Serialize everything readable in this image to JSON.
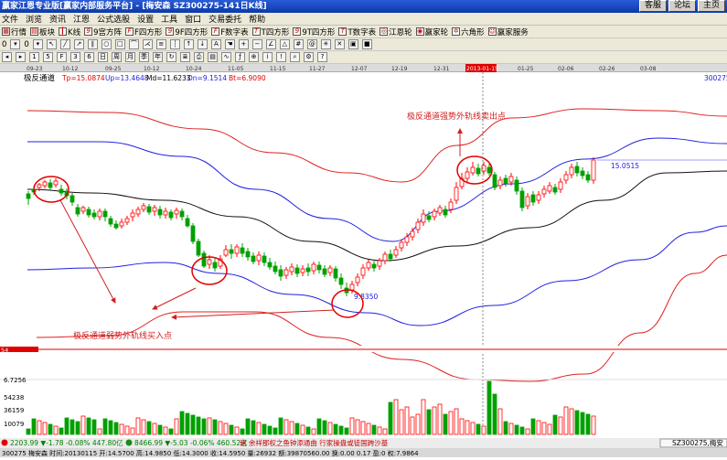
{
  "window": {
    "title": "赢家江恩专业版[赢家内部服务平台] - [梅安森  SZ300275-141日K线]",
    "buttons": [
      "客服",
      "论坛",
      "主页"
    ]
  },
  "menu": [
    "文件",
    "浏览",
    "资讯",
    "江恩",
    "公式选股",
    "设置",
    "工具",
    "窗口",
    "交易委托",
    "帮助"
  ],
  "toolbar1": [
    "行情",
    "板块",
    "K线",
    "9宫方阵",
    "F四方形",
    "9F四方形",
    "F数字表",
    "T四方形",
    "9T四方形",
    "T数字表",
    "江恩轮",
    "赢家轮",
    "六角形",
    "赢家服务"
  ],
  "toolbar2_left": [
    "0",
    "0"
  ],
  "time_axis": [
    "09-23",
    "10-12",
    "09-25",
    "10-12",
    "10-24",
    "11-05",
    "11-15",
    "11-27",
    "12-07",
    "12-19",
    "12-31",
    "2013-01-15",
    "01-25",
    "02-06",
    "02-26",
    "03-08"
  ],
  "indicator": {
    "name": "极反通道",
    "tp_label": "Tp=15.0874",
    "up_label": "Up=13.4648",
    "md_label": "Md=11.6233",
    "dn_label": "Dn=9.1514",
    "bt_label": "Bt=6.9090",
    "code": "300275"
  },
  "annotations": {
    "sell_text": "极反通道强势外轨线卖出点",
    "buy_text": "极反通道弱势外轨线买入点",
    "high_value": "15.0515",
    "low_value": "9.8350",
    "cursor_date": "2013-01-15"
  },
  "volume_axis": [
    "6.7256",
    "54238",
    "36159",
    "10079"
  ],
  "volume_panel_left": "54",
  "status": {
    "sh_index": "2203.99 ▼-1.78 -0.08% 447.80亿",
    "sz_index": "8466.99 ▼-5.03 -0.06% 460.52亿",
    "ticker_text": "诸  余祥那权之鱼钟添通曲  行家操盘或徒国跨沙基",
    "right_code": "SZ300275,梅安",
    "bottom_line": "300275 梅安森 时间:20130115 开:14.5700 高:14.9850 低:14.3000 收:14.5950 量:26932 额:39870560.00 换:0.00 0.17 盈:0 权:7.9864"
  },
  "colors": {
    "up": "#ff0000",
    "down": "#00a000",
    "mid": "#000000",
    "band_blue": "#2020e0",
    "band_red": "#e02020",
    "title_blue": "#1040c0"
  }
}
